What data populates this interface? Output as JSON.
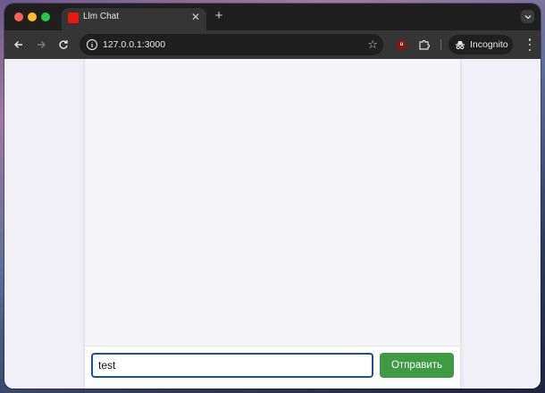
{
  "browser": {
    "tab": {
      "title": "Llm Chat",
      "favicon_color": "#e8190c"
    },
    "address_bar": {
      "url": "127.0.0.1:3000"
    },
    "incognito_label": "Incognito",
    "extensions": [
      {
        "name": "ublock-icon",
        "text": "u"
      }
    ]
  },
  "chat": {
    "messages": [],
    "input": {
      "value": "test"
    },
    "send_button": {
      "label": "Отправить",
      "color": "#3e9b43"
    }
  }
}
